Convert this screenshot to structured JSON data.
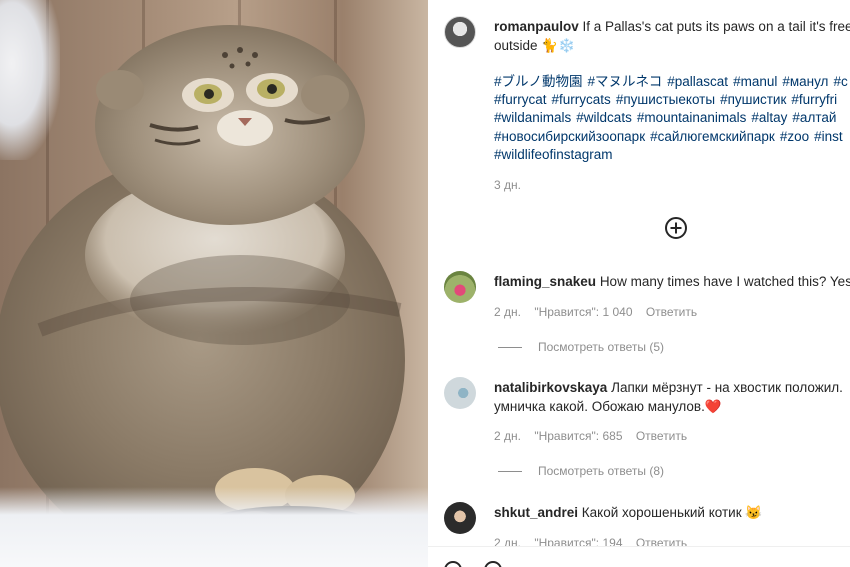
{
  "post": {
    "author": "romanpaulov",
    "caption_line1": "If a Pallas's cat puts its paws on a tail it's free",
    "caption_line2": "outside 🐈❄️",
    "hashtag_lines": [
      [
        "#ブルノ動物園",
        "#マヌルネコ",
        "#pallascat",
        "#manul",
        "#манул",
        "#с"
      ],
      [
        "#furrycat",
        "#furrycats",
        "#пушистыекоты",
        "#пушистик",
        "#furryfri"
      ],
      [
        "#wildanimals",
        "#wildcats",
        "#mountainanimals",
        "#altay",
        "#алтай"
      ],
      [
        "#новосибирскийзоопарк",
        "#сайлюгемскийпарк",
        "#zoo",
        "#inst"
      ],
      [
        "#wildlifeofinstagram"
      ]
    ],
    "time": "3 дн."
  },
  "load_more_icon": "plus-circle-icon",
  "comments": [
    {
      "user": "flaming_snakeu",
      "text_line1": "How many times have I watched this? Yes",
      "text_line2": "",
      "time": "2 дн.",
      "likes": "\"Нравится\": 1 040",
      "reply": "Ответить",
      "view_replies": "Посмотреть ответы (5)"
    },
    {
      "user": "natalibirkovskaya",
      "text_line1": "Лапки мёрзнут - на хвостик положил.",
      "text_line2": "умничка какой. Обожаю манулов.❤️",
      "time": "2 дн.",
      "likes": "\"Нравится\": 685",
      "reply": "Ответить",
      "view_replies": "Посмотреть ответы (8)"
    },
    {
      "user": "shkut_andrei",
      "text_line1": "Какой хорошенький котик 😼",
      "text_line2": "",
      "time": "2 дн.",
      "likes": "\"Нравится\": 194",
      "reply": "Ответить",
      "view_replies": ""
    }
  ],
  "colors": {
    "link": "#00376b",
    "muted": "#8e8e8e",
    "text": "#262626"
  }
}
